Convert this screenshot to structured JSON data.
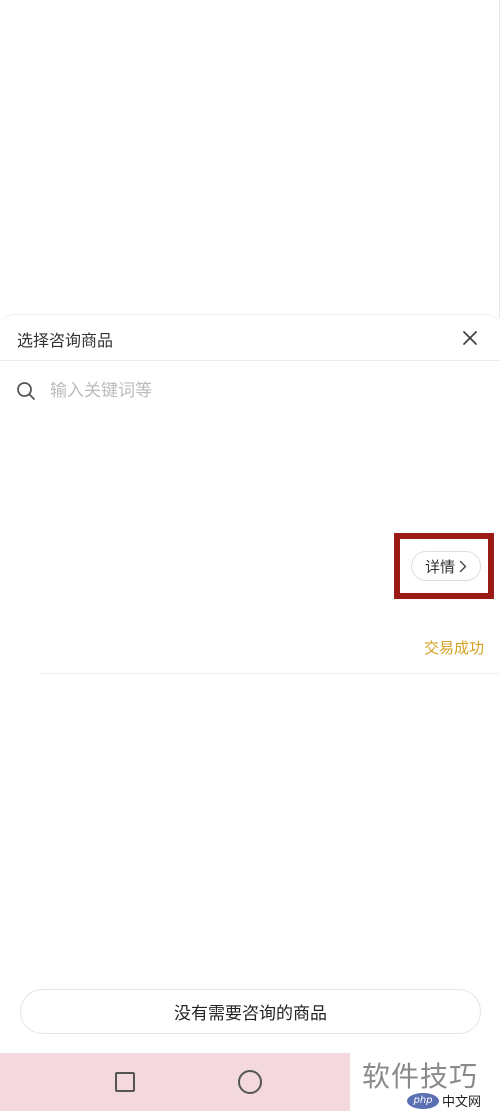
{
  "sheet": {
    "title": "选择咨询商品",
    "search_placeholder": "输入关键词等"
  },
  "order": {
    "detail_label": "详情",
    "status": "交易成功"
  },
  "footer": {
    "no_item_label": "没有需要咨询的商品"
  },
  "watermark": {
    "text": "软件技巧",
    "logo_text": "php",
    "site_text": "中文网"
  },
  "colors": {
    "status": "#d4a21f",
    "highlight": "#9b1a16",
    "nav_bg": "#f3d9de"
  }
}
